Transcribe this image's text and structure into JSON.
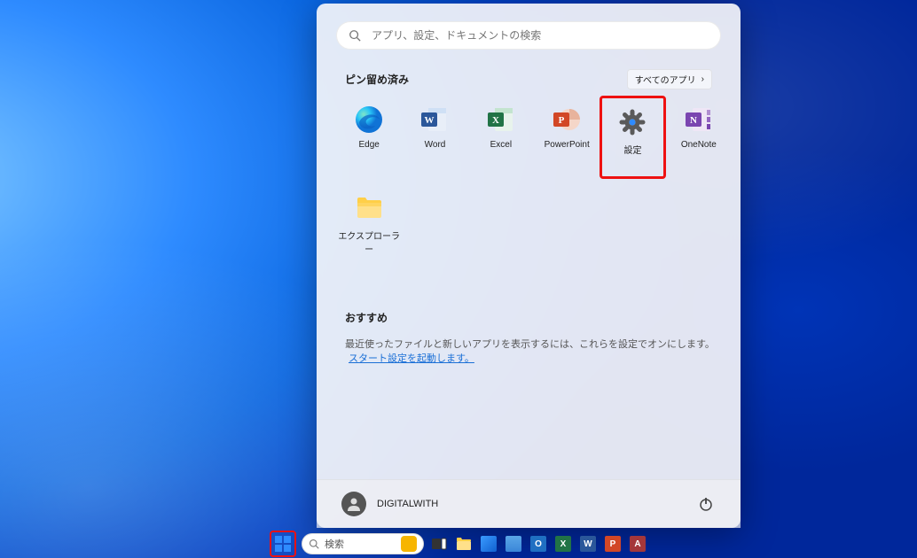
{
  "start_menu": {
    "search_placeholder": "アプリ、設定、ドキュメントの検索",
    "pinned": {
      "title": "ピン留め済み",
      "all_apps_label": "すべてのアプリ",
      "apps": [
        {
          "label": "Edge",
          "icon": "edge-icon"
        },
        {
          "label": "Word",
          "icon": "word-icon"
        },
        {
          "label": "Excel",
          "icon": "excel-icon"
        },
        {
          "label": "PowerPoint",
          "icon": "powerpoint-icon"
        },
        {
          "label": "設定",
          "icon": "settings-icon",
          "highlight": true
        },
        {
          "label": "OneNote",
          "icon": "onenote-icon"
        },
        {
          "label": "エクスプローラー",
          "icon": "explorer-icon"
        }
      ]
    },
    "recommended": {
      "title": "おすすめ",
      "message": "最近使ったファイルと新しいアプリを表示するには、これらを設定でオンにします。",
      "link": "スタート設定を起動します。"
    },
    "user": {
      "name": "DIGITALWITH"
    }
  },
  "taskbar": {
    "search_label": "検索",
    "icons": [
      {
        "name": "taskview-icon"
      },
      {
        "name": "explorer-icon"
      },
      {
        "name": "store-icon"
      },
      {
        "name": "notepad-icon"
      },
      {
        "name": "outlook-icon"
      },
      {
        "name": "excel-icon"
      },
      {
        "name": "word-icon"
      },
      {
        "name": "powerpoint-icon"
      },
      {
        "name": "access-icon"
      }
    ]
  },
  "colors": {
    "highlight": "#e11",
    "link": "#1a6fd6"
  }
}
